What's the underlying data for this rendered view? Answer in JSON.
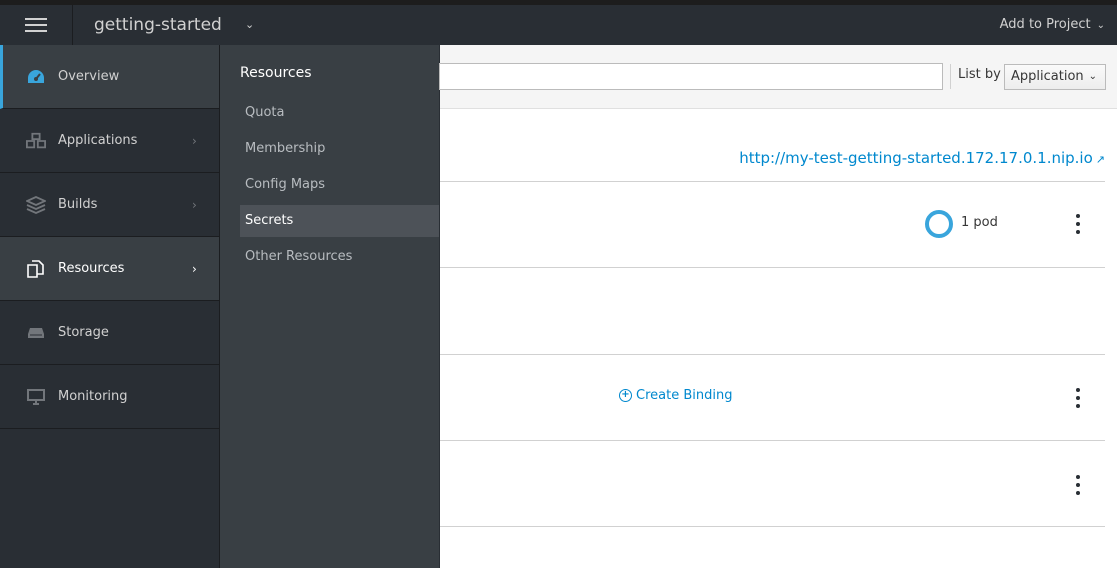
{
  "header": {
    "project_name": "getting-started",
    "add_to_project_label": "Add to Project"
  },
  "sidebar": {
    "items": [
      {
        "label": "Overview",
        "icon": "dashboard-icon",
        "active": true,
        "has_submenu": false
      },
      {
        "label": "Applications",
        "icon": "cubes-icon",
        "active": false,
        "has_submenu": true
      },
      {
        "label": "Builds",
        "icon": "layers-icon",
        "active": false,
        "has_submenu": true
      },
      {
        "label": "Resources",
        "icon": "copy-icon",
        "active": false,
        "hover": true,
        "has_submenu": true
      },
      {
        "label": "Storage",
        "icon": "hdd-icon",
        "active": false,
        "has_submenu": false
      },
      {
        "label": "Monitoring",
        "icon": "desktop-icon",
        "active": false,
        "has_submenu": false
      }
    ]
  },
  "secondary_menu": {
    "title": "Resources",
    "items": [
      {
        "label": "Quota",
        "active": false
      },
      {
        "label": "Membership",
        "active": false
      },
      {
        "label": "Config Maps",
        "active": false
      },
      {
        "label": "Secrets",
        "active": true
      },
      {
        "label": "Other Resources",
        "active": false
      }
    ]
  },
  "toolbar": {
    "filter_value": "",
    "list_by_label": "List by",
    "list_by_selected": "Application"
  },
  "content": {
    "route_url": "http://my-test-getting-started.172.17.0.1.nip.io",
    "pod_count_label": "1 pod",
    "create_binding_label": "Create Binding"
  },
  "colors": {
    "accent": "#39a5dc",
    "link": "#0088ce",
    "nav_bg": "#292e34",
    "secondary_bg": "#393f44"
  }
}
